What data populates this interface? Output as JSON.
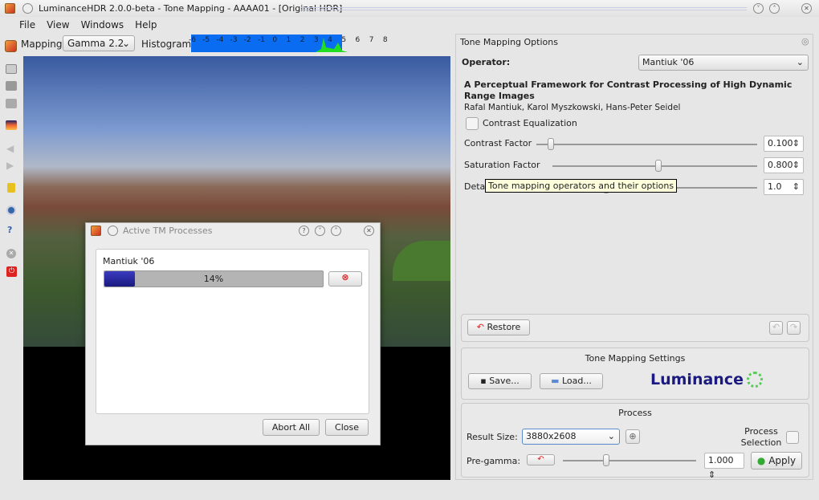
{
  "window": {
    "title": "LuminanceHDR 2.0.0-beta - Tone Mapping - AAAA01 - [Original HDR]"
  },
  "menu": [
    "File",
    "View",
    "Windows",
    "Help"
  ],
  "toolbar": {
    "mapping_label": "Mapping:",
    "mapping_value": "Gamma 2.2",
    "histogram_label": "Histogram:",
    "histogram_ticks": [
      "-6",
      "-5",
      "-4",
      "-3",
      "-2",
      "-1",
      "0",
      "1",
      "2",
      "3",
      "4",
      "5",
      "6",
      "7",
      "8"
    ]
  },
  "left_toolbar": [
    "tonemap-icon",
    "open-icon",
    "save-icon",
    "save-all-icon",
    "image-icon",
    "back-icon",
    "forward-icon",
    "lock-icon",
    "eye-icon",
    "help-icon",
    "close-icon",
    "quit-icon"
  ],
  "dialog": {
    "title": "Active TM Processes",
    "job_name": "Mantiuk '06",
    "progress_text": "14%",
    "progress": 14,
    "abort_all": "Abort All",
    "close": "Close"
  },
  "options": {
    "title": "Tone Mapping Options",
    "operator_label": "Operator:",
    "operator_value": "Mantiuk '06",
    "paper_title": "A Perceptual Framework for Contrast Processing of High Dynamic Range Images",
    "authors": "Rafal Mantiuk, Karol Myszkowski, Hans-Peter Seidel",
    "contrast_eq": "Contrast Equalization",
    "params": [
      {
        "label": "Contrast Factor",
        "value": "0.100",
        "pos": 0.05
      },
      {
        "label": "Saturation Factor",
        "value": "0.800",
        "pos": 0.5
      },
      {
        "label": "Deta",
        "value": "1.0",
        "pos": 0.3
      }
    ],
    "tooltip": "Tone mapping operators and their options",
    "restore": "Restore"
  },
  "settings": {
    "title": "Tone Mapping Settings",
    "save": "Save...",
    "load": "Load...",
    "logo": "Luminance"
  },
  "process": {
    "title": "Process",
    "result_size_label": "Result Size:",
    "result_size": "3880x2608",
    "process_selection": "Process Selection",
    "pregamma_label": "Pre-gamma:",
    "pregamma_value": "1.000",
    "apply": "Apply"
  },
  "colors": {
    "histogram_bg": "#0a6cf0",
    "histogram_data": "#22dd22",
    "logo": "#1a1a80",
    "progress": "#2a2aa0"
  }
}
